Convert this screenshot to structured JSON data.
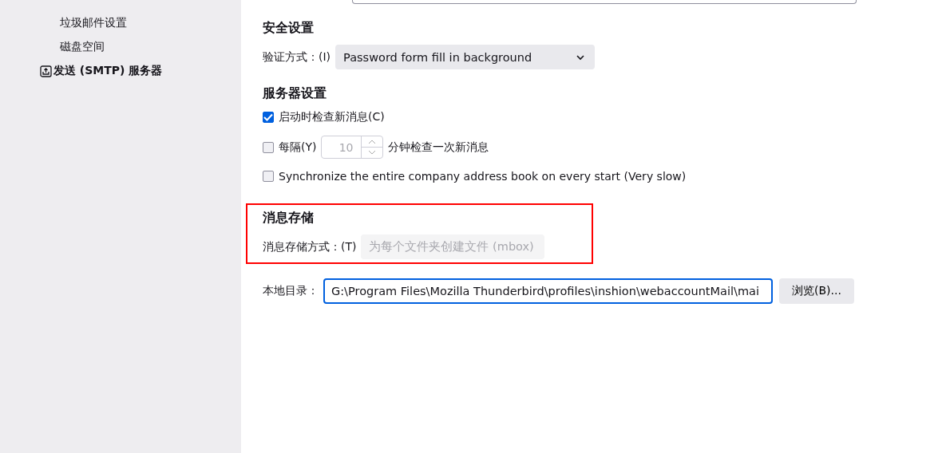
{
  "sidebar": {
    "items": [
      {
        "label": "垃圾邮件设置",
        "kind": "child",
        "selected": false
      },
      {
        "label": "磁盘空间",
        "kind": "child",
        "selected": false
      },
      {
        "label": "发送 (SMTP) 服务器",
        "kind": "top",
        "selected": false
      }
    ]
  },
  "sections": [
    {
      "kind": "partial_field"
    },
    {
      "kind": "group",
      "title": "安全设置",
      "highlighted": false,
      "rows": [
        {
          "kind": "select",
          "label": "验证方式：(I)",
          "value": "Password form fill in background",
          "disabled": false
        }
      ]
    },
    {
      "kind": "group",
      "title": "服务器设置",
      "highlighted": false,
      "rows": [
        {
          "kind": "checkbox",
          "label": "启动时检查新消息(C)",
          "checked": true
        },
        {
          "kind": "interval",
          "label": "每隔(Y)",
          "checked": false,
          "value": "10",
          "suffix": "分钟检查一次新消息",
          "disabled": true
        },
        {
          "kind": "checkbox",
          "label": "Synchronize the entire company address book on every start (Very slow)",
          "checked": false
        }
      ]
    },
    {
      "kind": "group",
      "title": "消息存储",
      "highlighted": true,
      "rows": [
        {
          "kind": "select",
          "label": "消息存储方式：(T)",
          "value": "为每个文件夹创建文件 (mbox)",
          "disabled": true
        }
      ]
    },
    {
      "kind": "path",
      "label": "本地目录：",
      "value": "G:\\Program Files\\Mozilla Thunderbird\\profiles\\inshion\\webaccountMail\\mai",
      "button": "浏览(B)..."
    }
  ]
}
